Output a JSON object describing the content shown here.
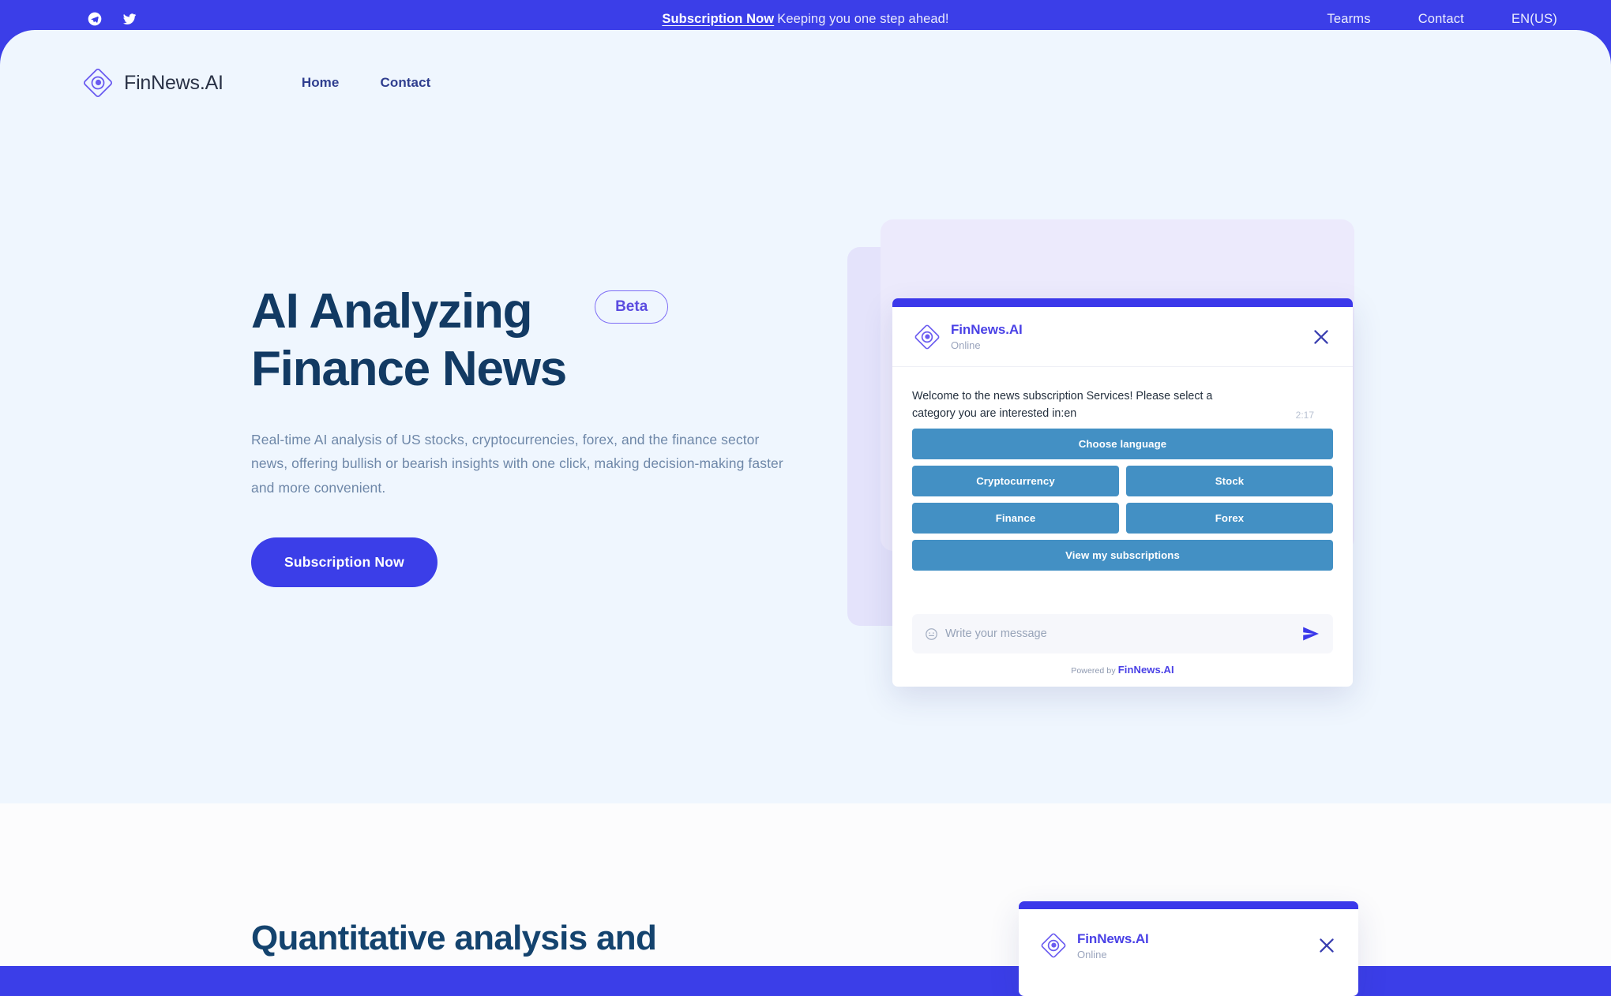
{
  "topbar": {
    "social": [
      {
        "name": "telegram-icon",
        "label": "Telegram"
      },
      {
        "name": "twitter-icon",
        "label": "Twitter"
      }
    ],
    "promo_link": "Subscription Now",
    "promo_text": "Keeping you one step ahead!",
    "links": [
      {
        "label": "Tearms"
      },
      {
        "label": "Contact"
      },
      {
        "label": "EN(US)"
      }
    ]
  },
  "nav": {
    "brand": "FinNews.AI",
    "links": [
      {
        "label": "Home"
      },
      {
        "label": "Contact"
      }
    ]
  },
  "hero": {
    "headline_line1": "AI Analyzing",
    "headline_line2": "Finance News",
    "badge": "Beta",
    "paragraph": "Real-time AI analysis of US stocks, cryptocurrencies, forex, and the finance sector news, offering bullish or bearish insights with one click, making decision-making faster and more convenient.",
    "cta": "Subscription Now"
  },
  "chat": {
    "title": "FinNews.AI",
    "status": "Online",
    "close_label": "×",
    "message": "Welcome to the news subscription Services! Please select a category you are interested in:en",
    "timestamp": "2:17",
    "quick_replies_row1": [
      "Choose language"
    ],
    "quick_replies_row2": [
      "Cryptocurrency",
      "Stock"
    ],
    "quick_replies_row3": [
      "Finance",
      "Forex"
    ],
    "quick_replies_row4": [
      "View my subscriptions"
    ],
    "input_placeholder": "Write your message",
    "input_value": "",
    "powered_prefix": "Powered by",
    "powered_brand": "FinNews.AI"
  },
  "section2": {
    "title": "Quantitative analysis and",
    "chat": {
      "title": "FinNews.AI",
      "status": "Online",
      "close_label": "×"
    }
  },
  "colors": {
    "brand_blue": "#3b3ee8",
    "hero_bg": "#eff6fe",
    "section2_bg": "#fcfcfd",
    "headline_navy": "#123a63",
    "quick_reply_blue": "#4390c4",
    "accent_purple": "#4a41e6"
  }
}
